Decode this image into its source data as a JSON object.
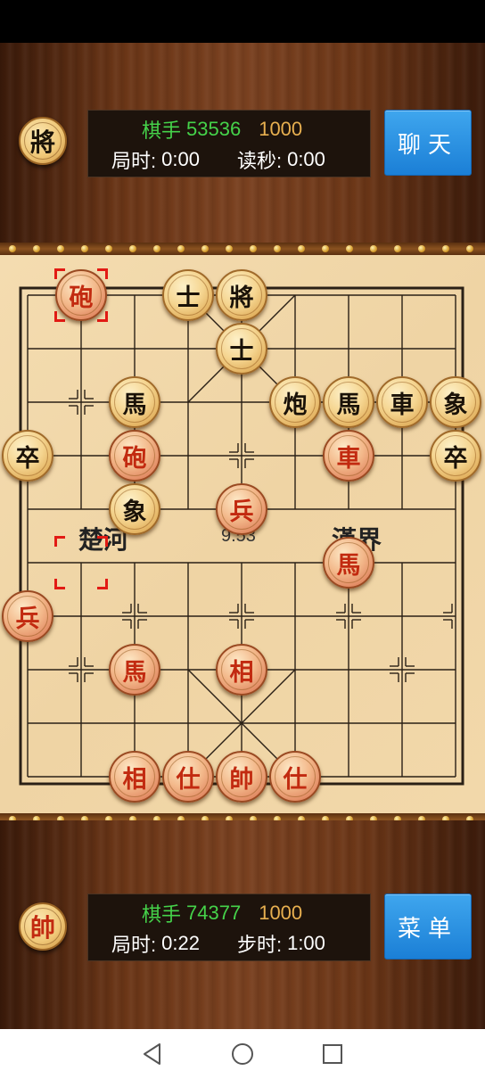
{
  "top_player": {
    "avatar_glyph": "將",
    "name_label": "棋手",
    "name_id": "53536",
    "score": "1000",
    "game_time_label": "局时:",
    "game_time": "0:00",
    "second_label": "读秒:",
    "second_time": "0:00",
    "button_label": "聊天"
  },
  "bottom_player": {
    "avatar_glyph": "帥",
    "name_label": "棋手",
    "name_id": "74377",
    "score": "1000",
    "game_time_label": "局时:",
    "game_time": "0:22",
    "second_label": "步时:",
    "second_time": "1:00",
    "button_label": "菜单"
  },
  "board": {
    "river_left": "楚河",
    "river_right": "漢界",
    "river_timer": "9.53",
    "pieces": [
      {
        "glyph": "砲",
        "color": "red",
        "col": 1,
        "row": 0
      },
      {
        "glyph": "士",
        "color": "black",
        "col": 3,
        "row": 0
      },
      {
        "glyph": "將",
        "color": "black",
        "col": 4,
        "row": 0
      },
      {
        "glyph": "士",
        "color": "black",
        "col": 4,
        "row": 1
      },
      {
        "glyph": "馬",
        "color": "black",
        "col": 2,
        "row": 2
      },
      {
        "glyph": "炮",
        "color": "black",
        "col": 5,
        "row": 2
      },
      {
        "glyph": "馬",
        "color": "black",
        "col": 6,
        "row": 2
      },
      {
        "glyph": "車",
        "color": "black",
        "col": 7,
        "row": 2
      },
      {
        "glyph": "象",
        "color": "black",
        "col": 8,
        "row": 2
      },
      {
        "glyph": "卒",
        "color": "black",
        "col": 0,
        "row": 3
      },
      {
        "glyph": "砲",
        "color": "red",
        "col": 2,
        "row": 3
      },
      {
        "glyph": "車",
        "color": "red",
        "col": 6,
        "row": 3
      },
      {
        "glyph": "卒",
        "color": "black",
        "col": 8,
        "row": 3
      },
      {
        "glyph": "象",
        "color": "black",
        "col": 2,
        "row": 4
      },
      {
        "glyph": "兵",
        "color": "red",
        "col": 4,
        "row": 4
      },
      {
        "glyph": "馬",
        "color": "red",
        "col": 6,
        "row": 5
      },
      {
        "glyph": "兵",
        "color": "red",
        "col": 0,
        "row": 6
      },
      {
        "glyph": "馬",
        "color": "red",
        "col": 2,
        "row": 7
      },
      {
        "glyph": "相",
        "color": "red",
        "col": 4,
        "row": 7
      },
      {
        "glyph": "相",
        "color": "red",
        "col": 2,
        "row": 9
      },
      {
        "glyph": "仕",
        "color": "red",
        "col": 3,
        "row": 9
      },
      {
        "glyph": "帥",
        "color": "red",
        "col": 4,
        "row": 9
      },
      {
        "glyph": "仕",
        "color": "red",
        "col": 5,
        "row": 9
      }
    ],
    "selection_markers": [
      {
        "col": 1,
        "row": 0
      },
      {
        "col": 1,
        "row": 5
      }
    ]
  },
  "nav": {
    "back": "back-icon",
    "home": "home-icon",
    "recents": "recents-icon"
  },
  "colors": {
    "green": "#45d24a",
    "gold": "#e8b050",
    "blue_button": "#2a90e0",
    "red_piece_text": "#c22a10"
  }
}
